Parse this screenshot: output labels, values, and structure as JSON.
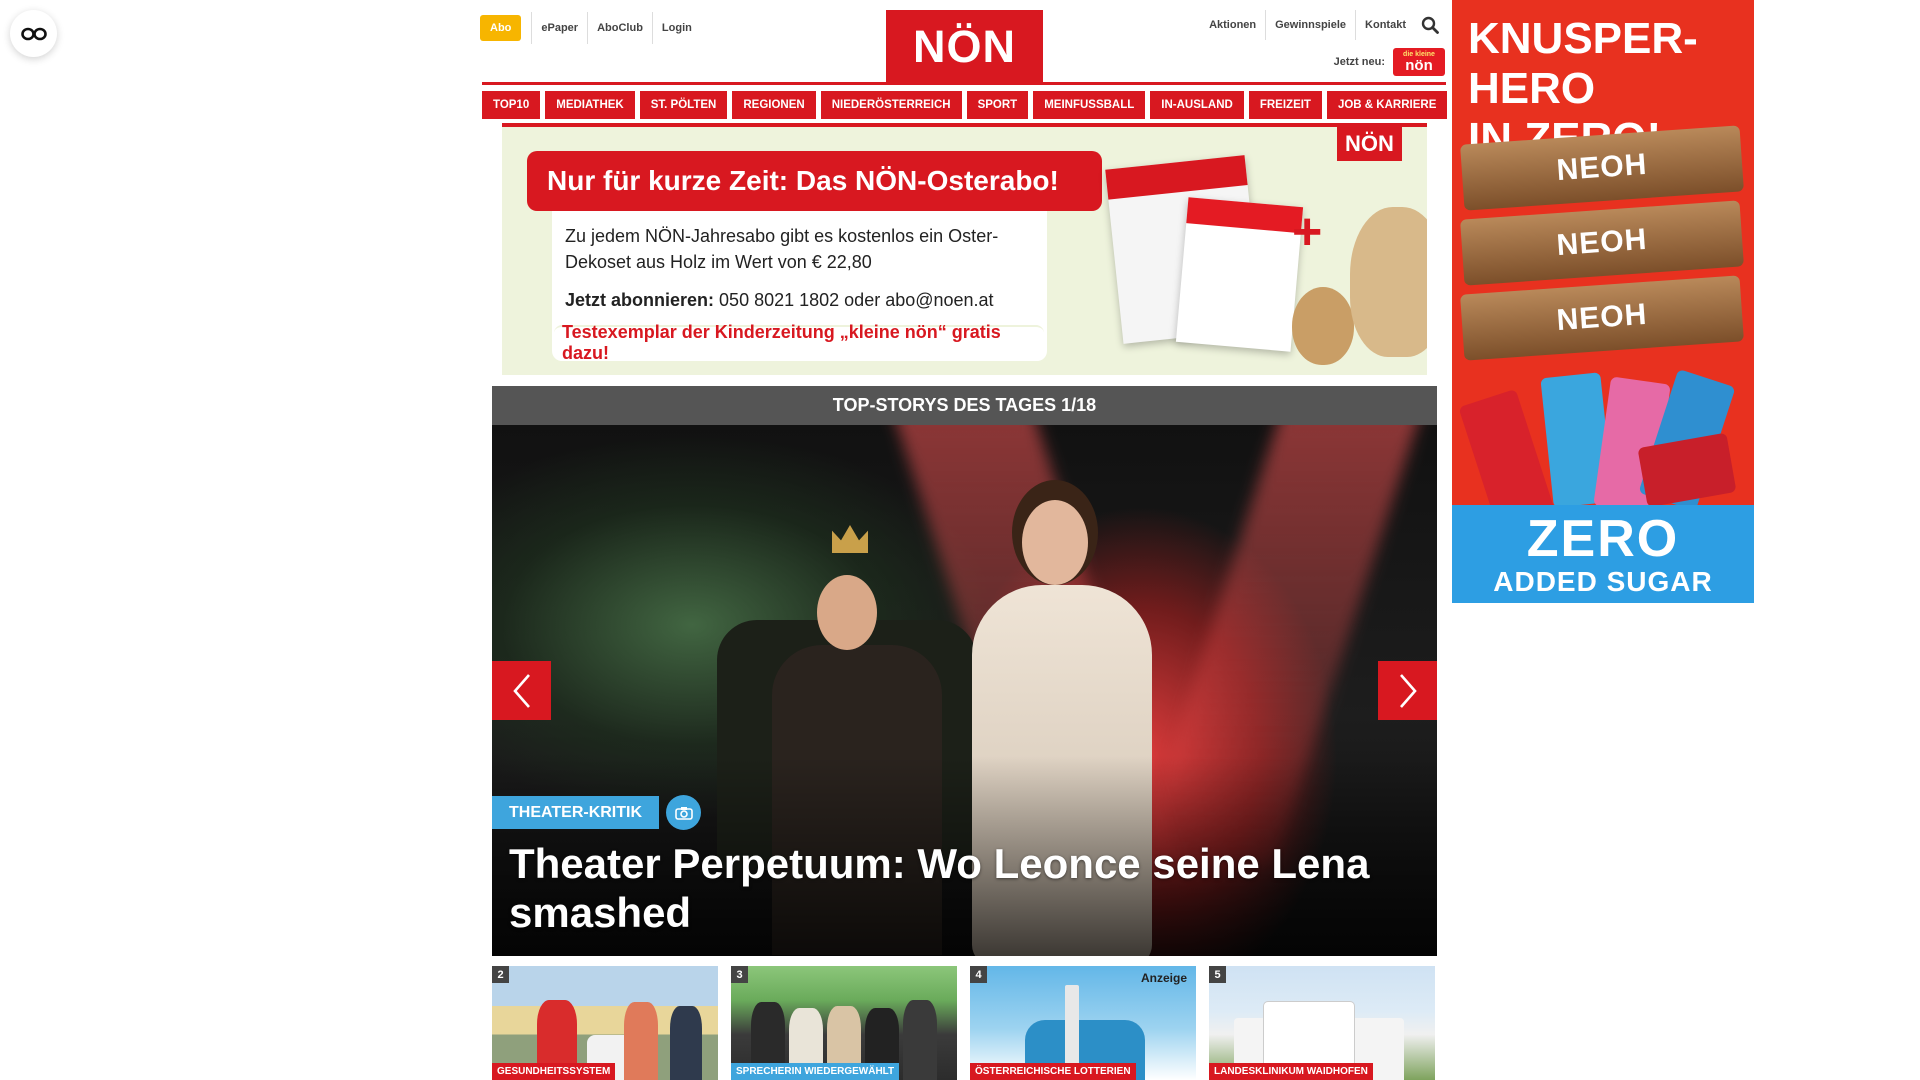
{
  "colors": {
    "brand_red": "#d81820",
    "abo_yellow": "#f7b500",
    "tag_blue": "#3ea5dd",
    "stories_bar": "#555555"
  },
  "accessibility": {
    "icon": "accessibility-glasses-icon"
  },
  "header": {
    "abo_label": "Abo",
    "left_links": [
      "ePaper",
      "AboClub",
      "Login"
    ],
    "logo_text": "NÖN",
    "right_links": [
      "Aktionen",
      "Gewinnspiele",
      "Kontakt"
    ],
    "search_icon": "search-icon",
    "jetzt_label": "Jetzt neu:",
    "kleine_noen_small": "die kleine",
    "kleine_noen_big": "nön"
  },
  "nav": {
    "items": [
      "TOP10",
      "MEDIATHEK",
      "ST. PÖLTEN",
      "REGIONEN",
      "NIEDERÖSTERREICH",
      "SPORT",
      "MEINFUSSBALL",
      "IN-AUSLAND",
      "FREIZEIT",
      "JOB & KARRIERE"
    ]
  },
  "promo": {
    "headline": "Nur für kurze Zeit: Das NÖN-Osterabo!",
    "body": "Zu jedem NÖN-Jahresabo gibt es kostenlos ein Oster-Dekoset aus Holz im Wert von € 22,80",
    "cta_bold": "Jetzt abonnieren:",
    "cta_rest": "050 8021 1802 oder abo@noen.at",
    "footer": "Testexemplar der Kinderzeitung „kleine nön“ gratis dazu!",
    "logo": "NÖN",
    "plus": "+"
  },
  "stories": {
    "bar_title": "TOP-STORYS DES TAGES 1/18",
    "hero": {
      "tag": "THEATER-KRITIK",
      "title": "Theater Perpetuum: Wo Leonce seine Lena smashed",
      "camera_icon": "camera-icon"
    },
    "prev_icon": "chevron-left-icon",
    "next_icon": "chevron-right-icon",
    "thumbs": [
      {
        "num": "2",
        "category": "GESUNDHEITSSYSTEM",
        "ad": ""
      },
      {
        "num": "3",
        "category": "SPRECHERIN WIEDERGEWÄHLT",
        "ad": ""
      },
      {
        "num": "4",
        "category": "ÖSTERREICHISCHE LOTTERIEN",
        "ad": "Anzeige"
      },
      {
        "num": "5",
        "category": "LANDESKLINIKUM WAIDHOFEN",
        "ad": ""
      }
    ]
  },
  "ad": {
    "headline_line1": "KNUSPER-HERO",
    "headline_line2": "IN ZERO!",
    "bar_brand": "NEOH",
    "bottom_big": "ZERO",
    "bottom_small": "ADDED SUGAR"
  }
}
